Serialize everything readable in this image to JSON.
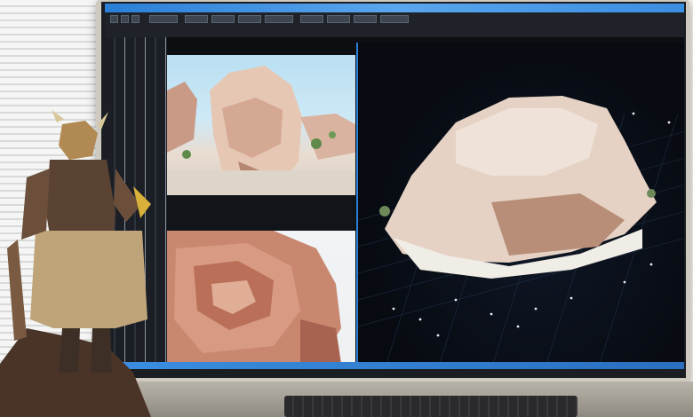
{
  "scene": {
    "description_tags": [
      "monitor",
      "photogrammetry-software",
      "figurine",
      "keyboard"
    ]
  },
  "app": {
    "window_title": "",
    "menu": [
      "",
      "",
      "",
      "",
      "",
      "",
      "",
      "",
      "",
      "",
      "",
      ""
    ]
  },
  "colors": {
    "accent": "#2a7fd6",
    "viewport_bg": "#070a10",
    "rock": "#e2c6b4"
  }
}
